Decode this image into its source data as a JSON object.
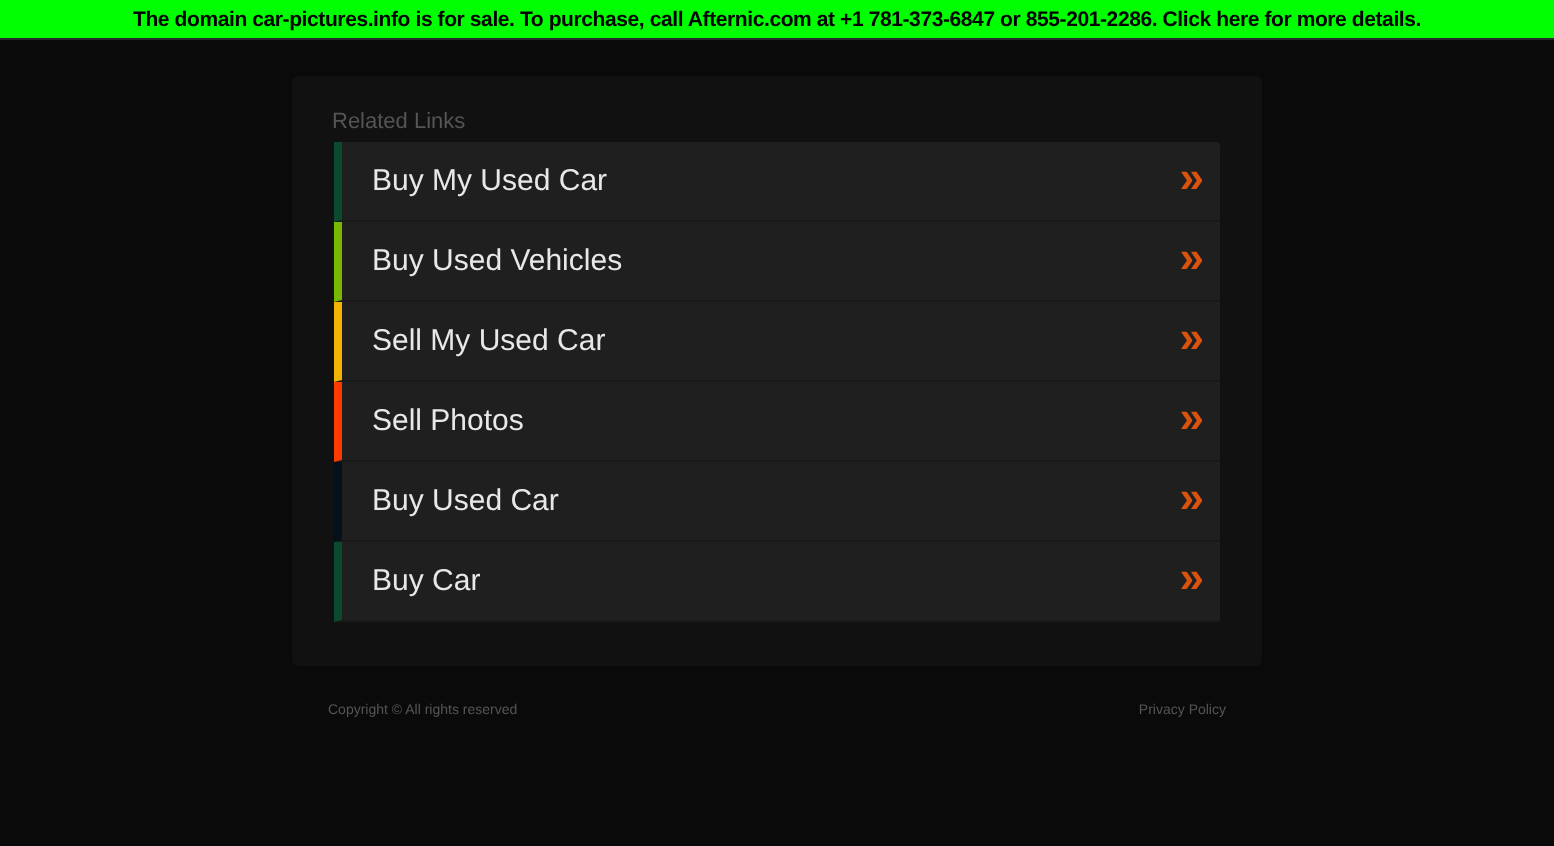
{
  "banner": {
    "text": "The domain car-pictures.info is for sale. To purchase, call Afternic.com at +1 781-373-6847 or 855-201-2286. Click here for more details."
  },
  "related_links": {
    "title": "Related Links",
    "items": [
      {
        "label": "Buy My Used Car",
        "arrow": "»",
        "color": "#0b4a2e"
      },
      {
        "label": "Buy Used Vehicles",
        "arrow": "»",
        "color": "#7ab800"
      },
      {
        "label": "Sell My Used Car",
        "arrow": "»",
        "color": "#f2b400"
      },
      {
        "label": "Sell Photos",
        "arrow": "»",
        "color": "#ff3a00"
      },
      {
        "label": "Buy Used Car",
        "arrow": "»",
        "color": "#04111b"
      },
      {
        "label": "Buy Car",
        "arrow": "»",
        "color": "#0b4a2e"
      }
    ]
  },
  "footer": {
    "copyright": "Copyright ©  All rights reserved",
    "privacy": "Privacy Policy"
  }
}
